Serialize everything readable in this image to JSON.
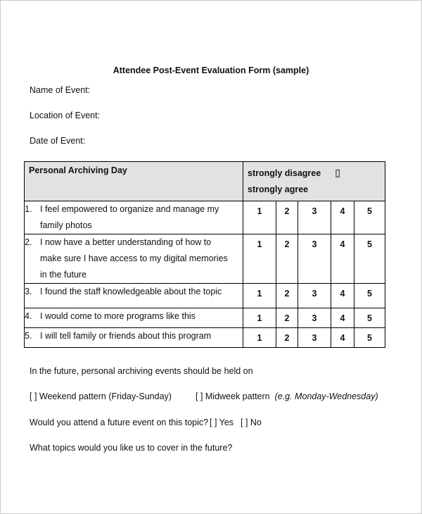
{
  "document": {
    "title": "Attendee Post-Event Evaluation Form (sample)",
    "fields": [
      "Name of Event:",
      "Location of Event:",
      "Date of Event:"
    ],
    "table": {
      "header_left": "Personal Archiving Day",
      "header_right_line1": "strongly disagree",
      "header_right_symbol": "▯",
      "header_right_line2": "strongly agree",
      "scale": [
        "1",
        "2",
        "3",
        "4",
        "5"
      ],
      "rows": [
        {
          "num": "1.",
          "text": "I feel empowered to organize and manage my family photos"
        },
        {
          "num": "2.",
          "text": "I now have a better understanding of how to make sure I have access to my digital memories in the future"
        },
        {
          "num": "3.",
          "text": "I found the staff knowledgeable about the topic"
        },
        {
          "num": "4.",
          "text": "I would come to more programs like this"
        },
        {
          "num": "5.",
          "text": "I will tell family or friends about this program"
        }
      ]
    },
    "q_future": "In the future, personal archiving events should be held on",
    "opt_weekend": "[ ] Weekend pattern (Friday-Sunday)",
    "opt_midweek": "[ ] Midweek pattern",
    "opt_midweek_example": "(e.g. Monday-Wednesday)",
    "q_attend": "Would you attend a future event on this topic?",
    "opt_yes": "[ ] Yes",
    "opt_no": "[ ] No",
    "q_topics": "What topics would you like us to cover in the future?"
  }
}
